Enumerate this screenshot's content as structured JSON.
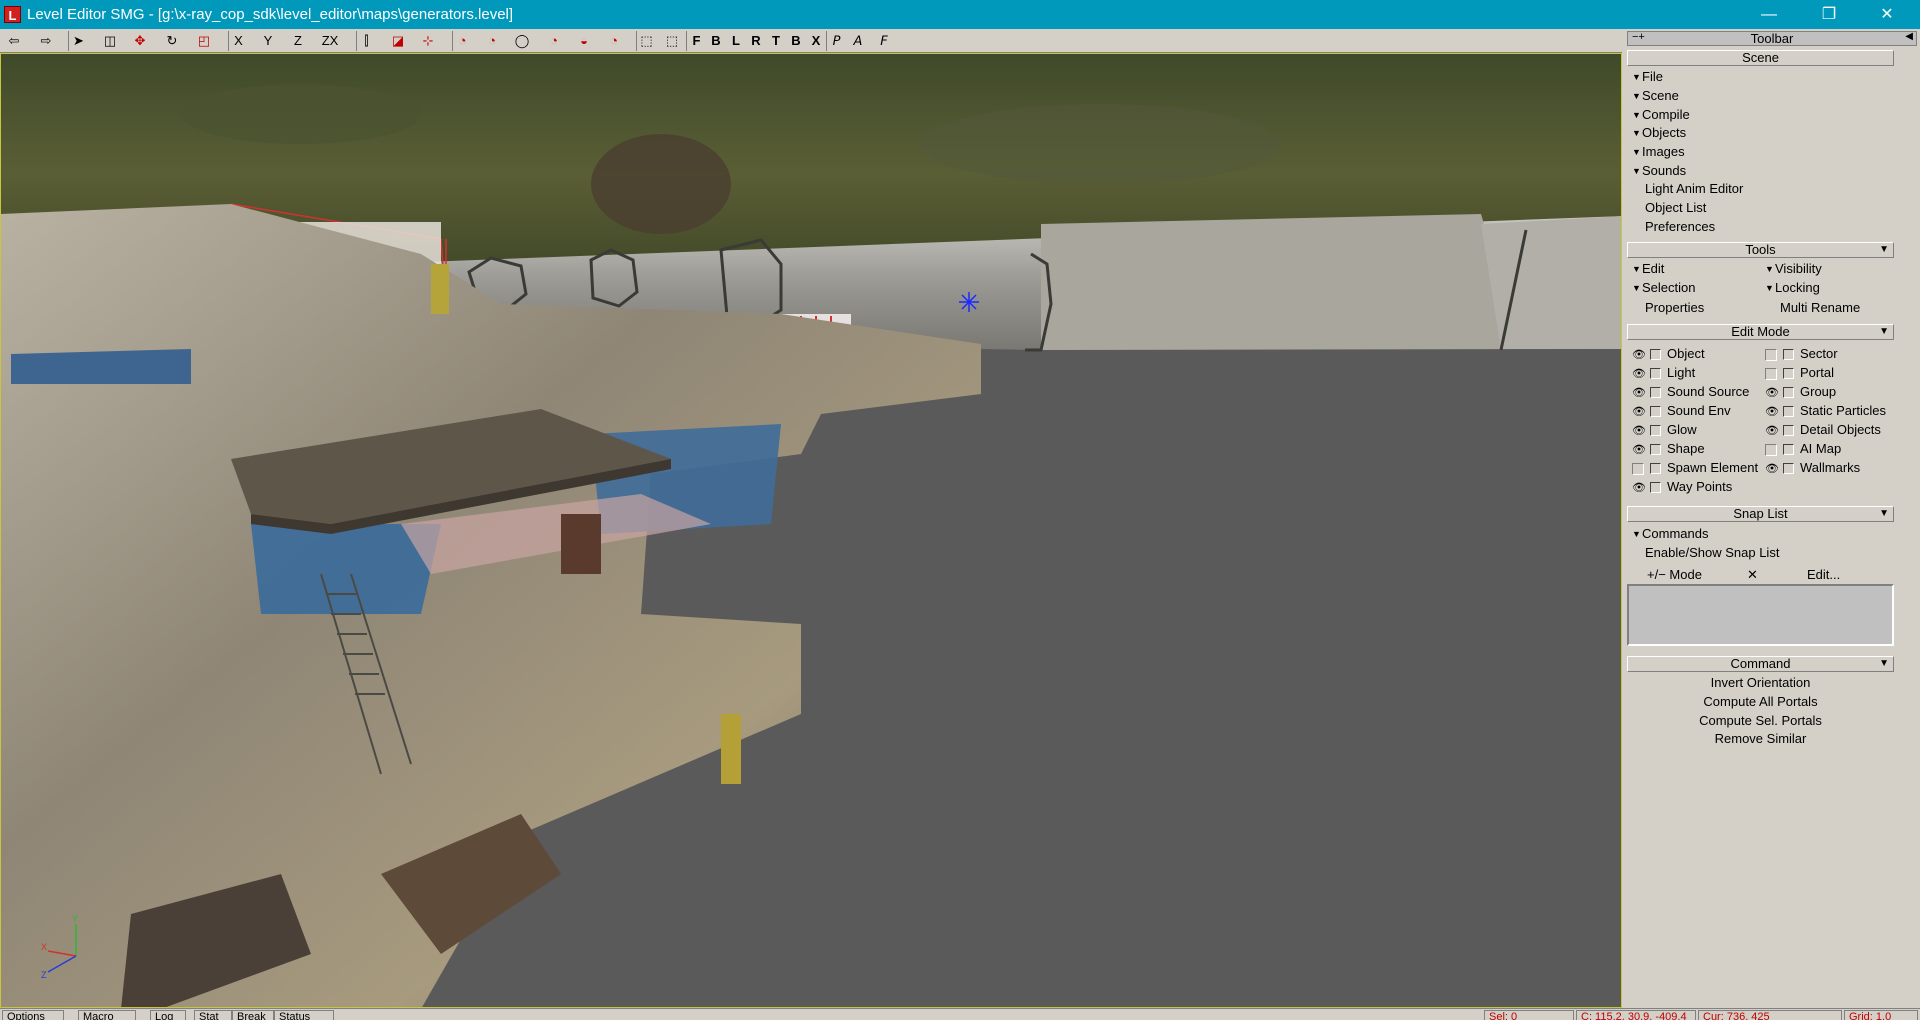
{
  "window": {
    "title": "Level Editor SMG - [g:\\x-ray_cop_sdk\\level_editor\\maps\\generators.level]",
    "app_icon_letter": "L",
    "minimize_icon": "—",
    "restore_icon": "❐",
    "close_icon": "✕"
  },
  "toolbar": {
    "undo": "⇦",
    "redo": "⇨",
    "select": "➤",
    "camera": "◫",
    "move": "✥",
    "rotate": "↻",
    "scale": "◰",
    "axis_x": "X",
    "axis_y": "Y",
    "axis_z": "Z",
    "axis_zx": "ZX",
    "grid": "⫿",
    "snap_object": "◪",
    "snap_grid": "⊹",
    "snap_angle": "◔",
    "snap_move": "◔",
    "snap_vertex": "◯",
    "snap_rotate": "◔",
    "snap_normal": "◒",
    "snap_other": "◔",
    "zoom_extent": "⬚",
    "zoom_sel": "⬚",
    "view_front": "F",
    "view_back": "B",
    "view_left": "L",
    "view_right": "R",
    "view_top": "T",
    "view_bottom": "B",
    "view_reset": "X",
    "render_p": "𝘗",
    "render_a": "𝘈",
    "render_f": "𝘍"
  },
  "panel": {
    "toolbar_title": "Toolbar",
    "scene": {
      "title": "Scene",
      "items": [
        "File",
        "Scene",
        "Compile",
        "Objects",
        "Images",
        "Sounds"
      ],
      "links": [
        "Light Anim Editor",
        "Object List",
        "Preferences"
      ]
    },
    "tools": {
      "title": "Tools",
      "edit": "Edit",
      "visibility": "Visibility",
      "selection": "Selection",
      "locking": "Locking",
      "properties": "Properties",
      "multi_rename": "Multi Rename"
    },
    "edit_mode": {
      "title": "Edit Mode",
      "left": [
        "Object",
        "Light",
        "Sound Source",
        "Sound Env",
        "Glow",
        "Shape",
        "Spawn Element",
        "Way Points"
      ],
      "right": [
        "Sector",
        "Portal",
        "Group",
        "Static Particles",
        "Detail Objects",
        "AI Map",
        "Wallmarks"
      ]
    },
    "snap_list": {
      "title": "Snap List",
      "commands": "Commands",
      "enable_show": "Enable/Show Snap List",
      "add_remove": "+/− Mode",
      "clear": "✕",
      "edit": "Edit..."
    },
    "command": {
      "title": "Command",
      "items": [
        "Invert Orientation",
        "Compute All Portals",
        "Compute Sel. Portals",
        "Remove Similar"
      ]
    }
  },
  "statusbar": {
    "options": "Options",
    "macro": "Macro",
    "log": "Log",
    "stat": "Stat",
    "break": "Break",
    "status": "Status",
    "sel": "Sel: 0",
    "coords": "C: 115.2, 30.9, -409.4",
    "cursor": "Cur: 736, 425",
    "grid": "Grid: 1.0"
  },
  "viewport": {
    "axis_y": "Y",
    "axis_x": "X",
    "axis_z": "Z"
  }
}
